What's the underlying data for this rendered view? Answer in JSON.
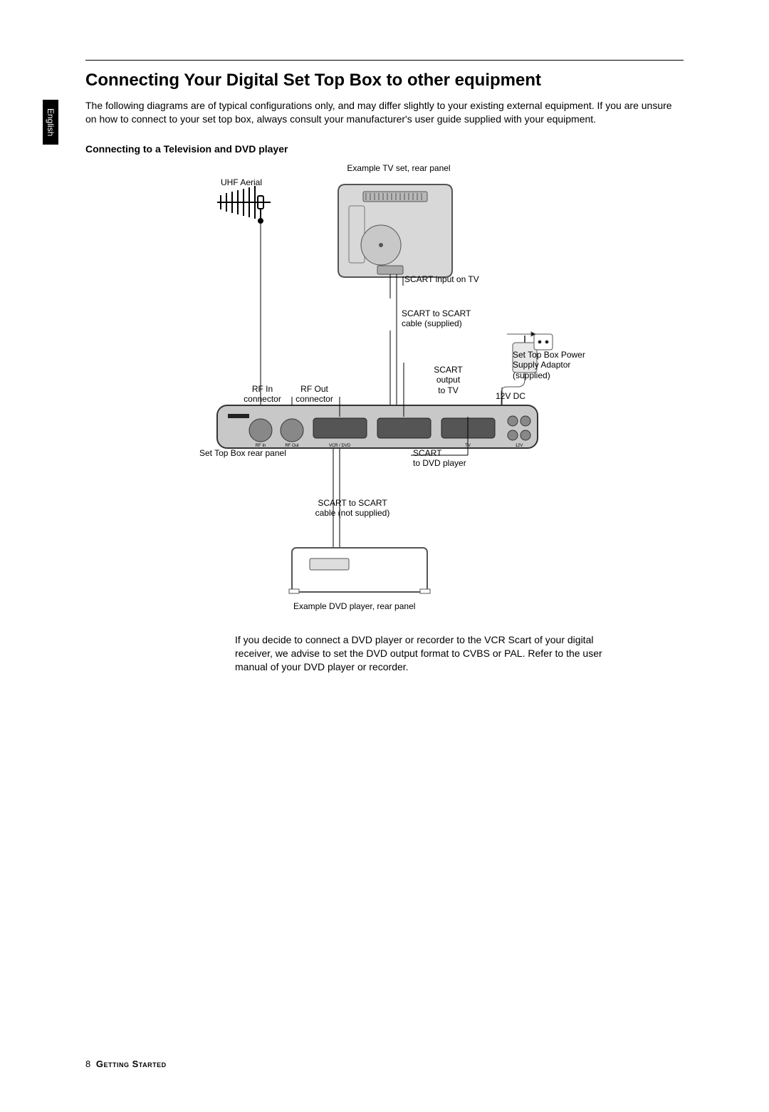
{
  "language_tab": "English",
  "title": "Connecting Your Digital Set Top Box to other equipment",
  "intro": "The following diagrams are of typical configurations only, and may differ slightly to your existing external equipment. If you are unsure on how to connect to your set top box, always consult your manufacturer's user guide supplied with your equipment.",
  "subheading": "Connecting to a Television and DVD player",
  "diagram": {
    "tv_caption": "Example TV set, rear panel",
    "uhf_aerial": "UHF Aerial",
    "scart_input_tv": "SCART input on TV",
    "scart_to_scart_supplied": "SCART to SCART\ncable (supplied)",
    "power_adaptor": "Set Top Box Power\nSupply Adaptor\n(supplied)",
    "rf_in": "RF In\nconnector",
    "rf_out": "RF Out\nconnector",
    "scart_out_tv": "SCART\noutput\nto TV",
    "twelve_v": "12V DC",
    "stb_rear": "Set Top Box rear panel",
    "scart_to_dvd": "SCART\nto DVD player",
    "scart_to_scart_not_supplied": "SCART to SCART\ncable (not supplied)",
    "dvd_caption": "Example DVD player, rear panel",
    "stb_ports": {
      "rf_in": "RF In",
      "rf_out": "RF Out",
      "vcr_dvd": "VCR / DVD",
      "tv": "TV",
      "twelve_v": "12V"
    }
  },
  "advice": "If you decide to connect a DVD player or recorder to the VCR Scart of your digital receiver, we advise to set the DVD output format to CVBS or PAL. Refer to the user manual of your DVD player or recorder.",
  "footer": {
    "page": "8",
    "section": "Getting Started"
  }
}
